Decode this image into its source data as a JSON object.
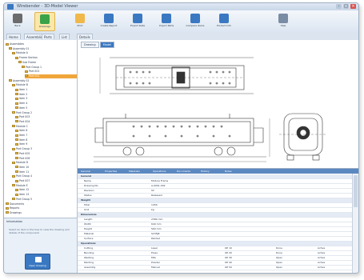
{
  "window": {
    "title": "Wirebender - 3D-Model Viewer"
  },
  "ribbon": {
    "buttons": [
      {
        "label": "Back",
        "icon": "back-arrow-icon",
        "color": "#6b6b6b"
      },
      {
        "label": "Drawings",
        "icon": "drawings-icon",
        "color": "#3aa34a"
      },
      {
        "label": "Print",
        "icon": "print-icon",
        "color": "#f0b84a"
      },
      {
        "label": "Create Report",
        "icon": "report-icon",
        "color": "#3a78c2"
      },
      {
        "label": "Export Data",
        "icon": "export-icon",
        "color": "#3a78c2"
      },
      {
        "label": "Import Parts",
        "icon": "import-icon",
        "color": "#3a78c2"
      },
      {
        "label": "Compare Items",
        "icon": "compare-icon",
        "color": "#3a78c2"
      },
      {
        "label": "Product Info",
        "icon": "product-icon",
        "color": "#3a78c2"
      },
      {
        "label": "Help",
        "icon": "help-icon",
        "color": "#7a8ca3"
      }
    ]
  },
  "tabs": [
    "Home",
    "Assemblies",
    "Parts",
    "List",
    "Details"
  ],
  "tree": {
    "items": [
      "Assemblies",
      "Assembly 01",
      "Module A",
      "Frame Section",
      "Sub Frame",
      "Part Group 1",
      "Part 001",
      "Part 002",
      "Assembly 02",
      "Module B",
      "Item 1",
      "Item 2",
      "Item 3",
      "Item 4",
      "Item 5",
      "Part Group 2",
      "Part 003",
      "Part 004",
      "Module C",
      "Item 6",
      "Item 7",
      "Item 8",
      "Item 9",
      "Part Group 3",
      "Part 005",
      "Part 006",
      "Module D",
      "Item 10",
      "Item 11",
      "Part Group 4",
      "Part 007",
      "Module E",
      "Item 12",
      "Item 13",
      "Part Group 5",
      "Documents",
      "Reports",
      "Drawings"
    ],
    "selected_index": 7
  },
  "info": {
    "title": "Information",
    "text": "Select an item in the tree to view the drawing and details of the component.",
    "thumb_label": "Open Drawing"
  },
  "viewer": {
    "tabs": [
      "Drawing",
      "Model"
    ]
  },
  "details": {
    "tabs": [
      "General",
      "Properties",
      "Materials",
      "Operations",
      "Documents",
      "History",
      "Notes"
    ],
    "rows": [
      {
        "section": true,
        "a": "General"
      },
      {
        "a": "Name",
        "b": "Module Frame"
      },
      {
        "a": "Drawing No.",
        "b": "A-0001-002"
      },
      {
        "a": "Revision",
        "b": "02"
      },
      {
        "a": "Status",
        "b": "Released"
      },
      {
        "section": true,
        "a": "Weight"
      },
      {
        "a": "Total",
        "b": "1450"
      },
      {
        "a": "Unit",
        "b": "kg"
      },
      {
        "section": true,
        "a": "Dimensions"
      },
      {
        "a": "Length",
        "b": "2380 mm"
      },
      {
        "a": "Width",
        "b": "640 mm"
      },
      {
        "a": "Height",
        "b": "560 mm"
      },
      {
        "a": "Material",
        "b": "S235JR"
      },
      {
        "a": "Surface",
        "b": "Painted"
      },
      {
        "section": true,
        "a": "Operations"
      },
      {
        "a": "Cutting",
        "b": "Laser",
        "c": "OP 10",
        "d": "Done",
        "e": "Active"
      },
      {
        "a": "Bending",
        "b": "Press",
        "c": "OP 20",
        "d": "Done",
        "e": "Active"
      },
      {
        "a": "Welding",
        "b": "MIG",
        "c": "OP 30",
        "d": "Open",
        "e": "Active"
      },
      {
        "a": "Painting",
        "b": "Powder",
        "c": "OP 40",
        "d": "Open",
        "e": "Active"
      },
      {
        "a": "Assembly",
        "b": "Manual",
        "c": "OP 50",
        "d": "Open",
        "e": "Active"
      }
    ]
  }
}
